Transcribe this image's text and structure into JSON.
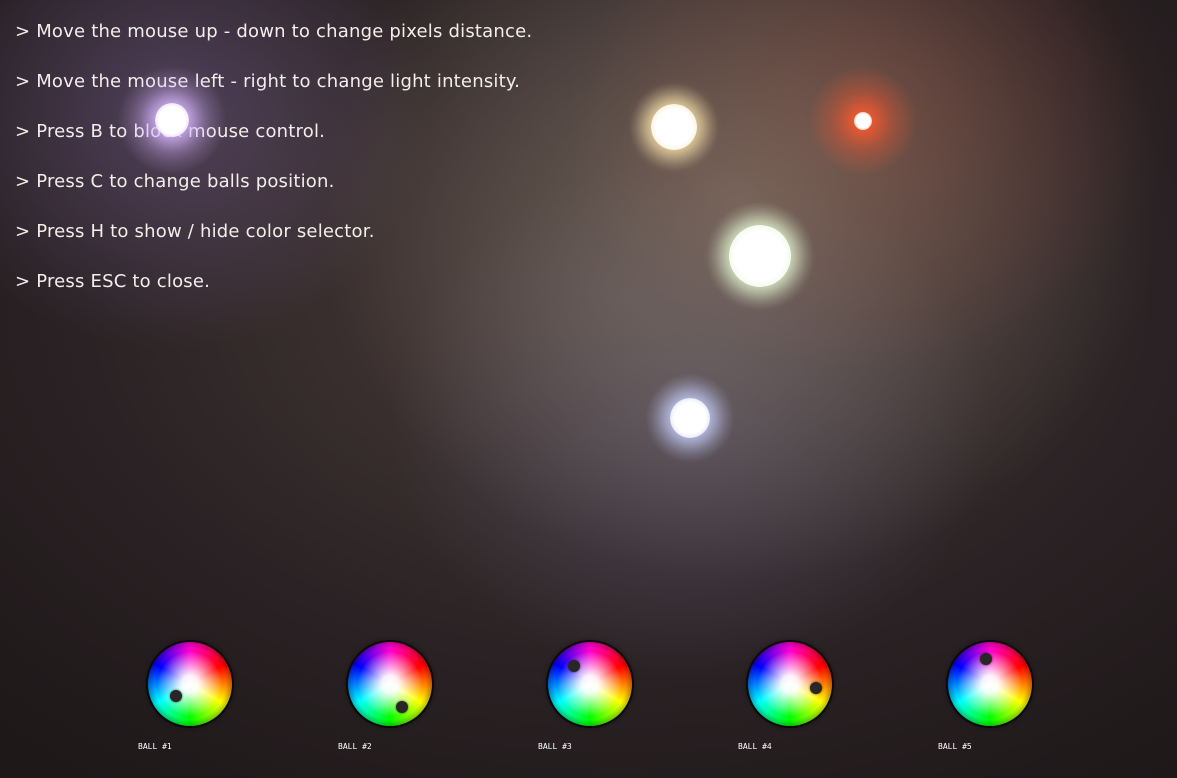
{
  "instructions": [
    "> Move the mouse up - down to change pixels distance.",
    "> Move the mouse left - right to change light intensity.",
    "> Press B to block mouse control.",
    "> Press C to change balls position.",
    "> Press H to show / hide color selector.",
    "> Press ESC to close."
  ],
  "balls": [
    {
      "label": "BALL #1",
      "color": "#d9b8ff",
      "icon": "light-ball-violet"
    },
    {
      "label": "BALL #2",
      "color": "#ff5a2e",
      "icon": "light-ball-red"
    },
    {
      "label": "BALL #3",
      "color": "#ffe9b0",
      "icon": "light-ball-warm-white"
    },
    {
      "label": "BALL #4",
      "color": "#eaffd8",
      "icon": "light-ball-pale-green"
    },
    {
      "label": "BALL #5",
      "color": "#c8d0ff",
      "icon": "light-ball-pale-blue"
    }
  ],
  "color_selector": {
    "wheels": [
      {
        "label": "BALL #1",
        "selector_icon": "color-wheel-icon"
      },
      {
        "label": "BALL #2",
        "selector_icon": "color-wheel-icon"
      },
      {
        "label": "BALL #3",
        "selector_icon": "color-wheel-icon"
      },
      {
        "label": "BALL #4",
        "selector_icon": "color-wheel-icon"
      },
      {
        "label": "BALL #5",
        "selector_icon": "color-wheel-icon"
      }
    ]
  }
}
